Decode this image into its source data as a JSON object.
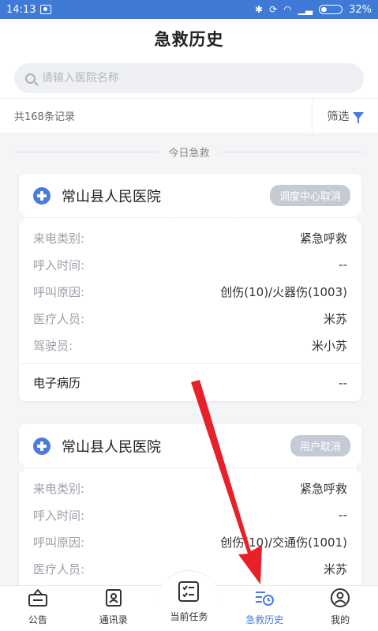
{
  "status": {
    "time": "14:13",
    "battery": "32%"
  },
  "header": {
    "title": "急救历史"
  },
  "search": {
    "placeholder": "请输入医院名称"
  },
  "filterbar": {
    "count_text": "共168条记录",
    "filter_label": "筛选"
  },
  "section": {
    "title": "今日急救"
  },
  "cards": [
    {
      "hospital": "常山县人民医院",
      "badge": "调度中心取消",
      "rows": [
        {
          "k": "来电类别:",
          "v": "紧急呼救"
        },
        {
          "k": "呼入时间:",
          "v": "--"
        },
        {
          "k": "呼叫原因:",
          "v": "创伤(10)/火器伤(1003)"
        },
        {
          "k": "医疗人员:",
          "v": "米苏"
        },
        {
          "k": "驾驶员:",
          "v": "米小苏"
        }
      ],
      "foot": {
        "k": "电子病历",
        "v": "--"
      }
    },
    {
      "hospital": "常山县人民医院",
      "badge": "用户取消",
      "rows": [
        {
          "k": "来电类别:",
          "v": "紧急呼救"
        },
        {
          "k": "呼入时间:",
          "v": "--"
        },
        {
          "k": "呼叫原因:",
          "v": "创伤(10)/交通伤(1001)"
        },
        {
          "k": "医疗人员:",
          "v": "米苏"
        }
      ]
    }
  ],
  "tabs": [
    {
      "label": "公告",
      "icon": "announcement-icon"
    },
    {
      "label": "通讯录",
      "icon": "contacts-icon"
    },
    {
      "label": "当前任务",
      "icon": "task-list-icon"
    },
    {
      "label": "急救历史",
      "icon": "history-icon"
    },
    {
      "label": "我的",
      "icon": "profile-icon"
    }
  ],
  "colors": {
    "accent": "#4a7be0",
    "status_bar": "#3f7ad6",
    "badge": "#c5cbd6",
    "arrow": "#e8202a"
  }
}
